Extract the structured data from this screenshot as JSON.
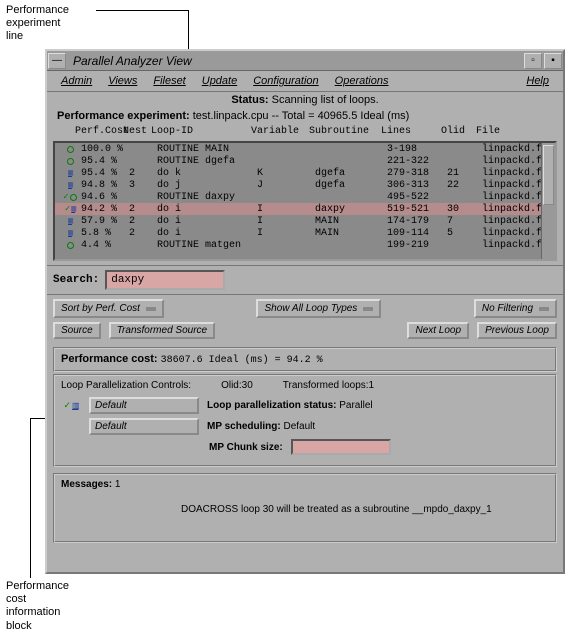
{
  "annotations": {
    "top": "Performance\nexperiment\nline",
    "bottom": "Performance\ncost\ninformation\nblock"
  },
  "title": "Parallel Analyzer View",
  "menus": {
    "admin": "Admin",
    "views": "Views",
    "fileset": "Fileset",
    "update": "Update",
    "config": "Configuration",
    "ops": "Operations",
    "help": "Help"
  },
  "status_label": "Status:",
  "status_text": "Scanning list of loops.",
  "pe_label": "Performance experiment:",
  "pe_text": "test.linpack.cpu -- Total = 40965.5 Ideal (ms)",
  "columns": {
    "c1": "Perf.Cost",
    "c2": "Nest",
    "c3": "Loop-ID",
    "c4": "Variable",
    "c5": "Subroutine",
    "c6": "Lines",
    "c7": "Olid",
    "c8": "File"
  },
  "rows": [
    {
      "icon": "circle",
      "pc": "100.0 %",
      "nest": "",
      "loop": "ROUTINE MAIN",
      "var": "",
      "sub": "",
      "lines": "3-198",
      "olid": "",
      "file": "linpackd.f"
    },
    {
      "icon": "circle",
      "pc": "95.4 %",
      "nest": "",
      "loop": "ROUTINE dgefa",
      "var": "",
      "sub": "",
      "lines": "221-322",
      "olid": "",
      "file": "linpackd.f"
    },
    {
      "icon": "bars",
      "pc": "95.4 %",
      "nest": "2",
      "loop": "do k",
      "var": "K",
      "sub": "dgefa",
      "lines": "279-318",
      "olid": "21",
      "file": "linpackd.f"
    },
    {
      "icon": "bars",
      "pc": "94.8 %",
      "nest": "3",
      "loop": "do j",
      "var": "J",
      "sub": "dgefa",
      "lines": "306-313",
      "olid": "22",
      "file": "linpackd.f"
    },
    {
      "icon": "check-circle",
      "pc": "94.6 %",
      "nest": "",
      "loop": "ROUTINE daxpy",
      "var": "",
      "sub": "",
      "lines": "495-522",
      "olid": "",
      "file": "linpackd.f"
    },
    {
      "icon": "check-bars",
      "pc": "94.2 %",
      "nest": "2",
      "loop": "do i",
      "var": "I",
      "sub": "daxpy",
      "lines": "519-521",
      "olid": "30",
      "file": "linpackd.f",
      "selected": true
    },
    {
      "icon": "bars",
      "pc": "57.9 %",
      "nest": "2",
      "loop": "do i",
      "var": "I",
      "sub": "MAIN",
      "lines": "174-179",
      "olid": "7",
      "file": "linpackd.f"
    },
    {
      "icon": "bars",
      "pc": "5.8 %",
      "nest": "2",
      "loop": "do i",
      "var": "I",
      "sub": "MAIN",
      "lines": "109-114",
      "olid": "5",
      "file": "linpackd.f"
    },
    {
      "icon": "circle",
      "pc": "4.4 %",
      "nest": "",
      "loop": "ROUTINE matgen",
      "var": "",
      "sub": "",
      "lines": "199-219",
      "olid": "",
      "file": "linpackd.f"
    }
  ],
  "search": {
    "label": "Search:",
    "value": "daxpy"
  },
  "buttons": {
    "sort": "Sort by Perf. Cost",
    "show": "Show All Loop Types",
    "filter": "No Filtering",
    "source": "Source",
    "tsource": "Transformed Source",
    "next": "Next Loop",
    "prev": "Previous Loop"
  },
  "perfcost": {
    "label": "Performance cost:",
    "text": "38607.6 Ideal (ms) =  94.2 %"
  },
  "lpc": {
    "header": "Loop Parallelization Controls:",
    "olid": "Olid:30",
    "tloops": "Transformed loops:1",
    "opt1": "Default",
    "stat_label": "Loop parallelization status:",
    "stat_val": "Parallel",
    "opt2": "Default",
    "sched_label": "MP scheduling:",
    "sched_val": "Default",
    "chunk_label": "MP Chunk size:",
    "chunk_val": ""
  },
  "messages": {
    "header": "Messages:",
    "count": "1",
    "text": "DOACROSS loop 30 will be treated as a subroutine __mpdo_daxpy_1"
  }
}
